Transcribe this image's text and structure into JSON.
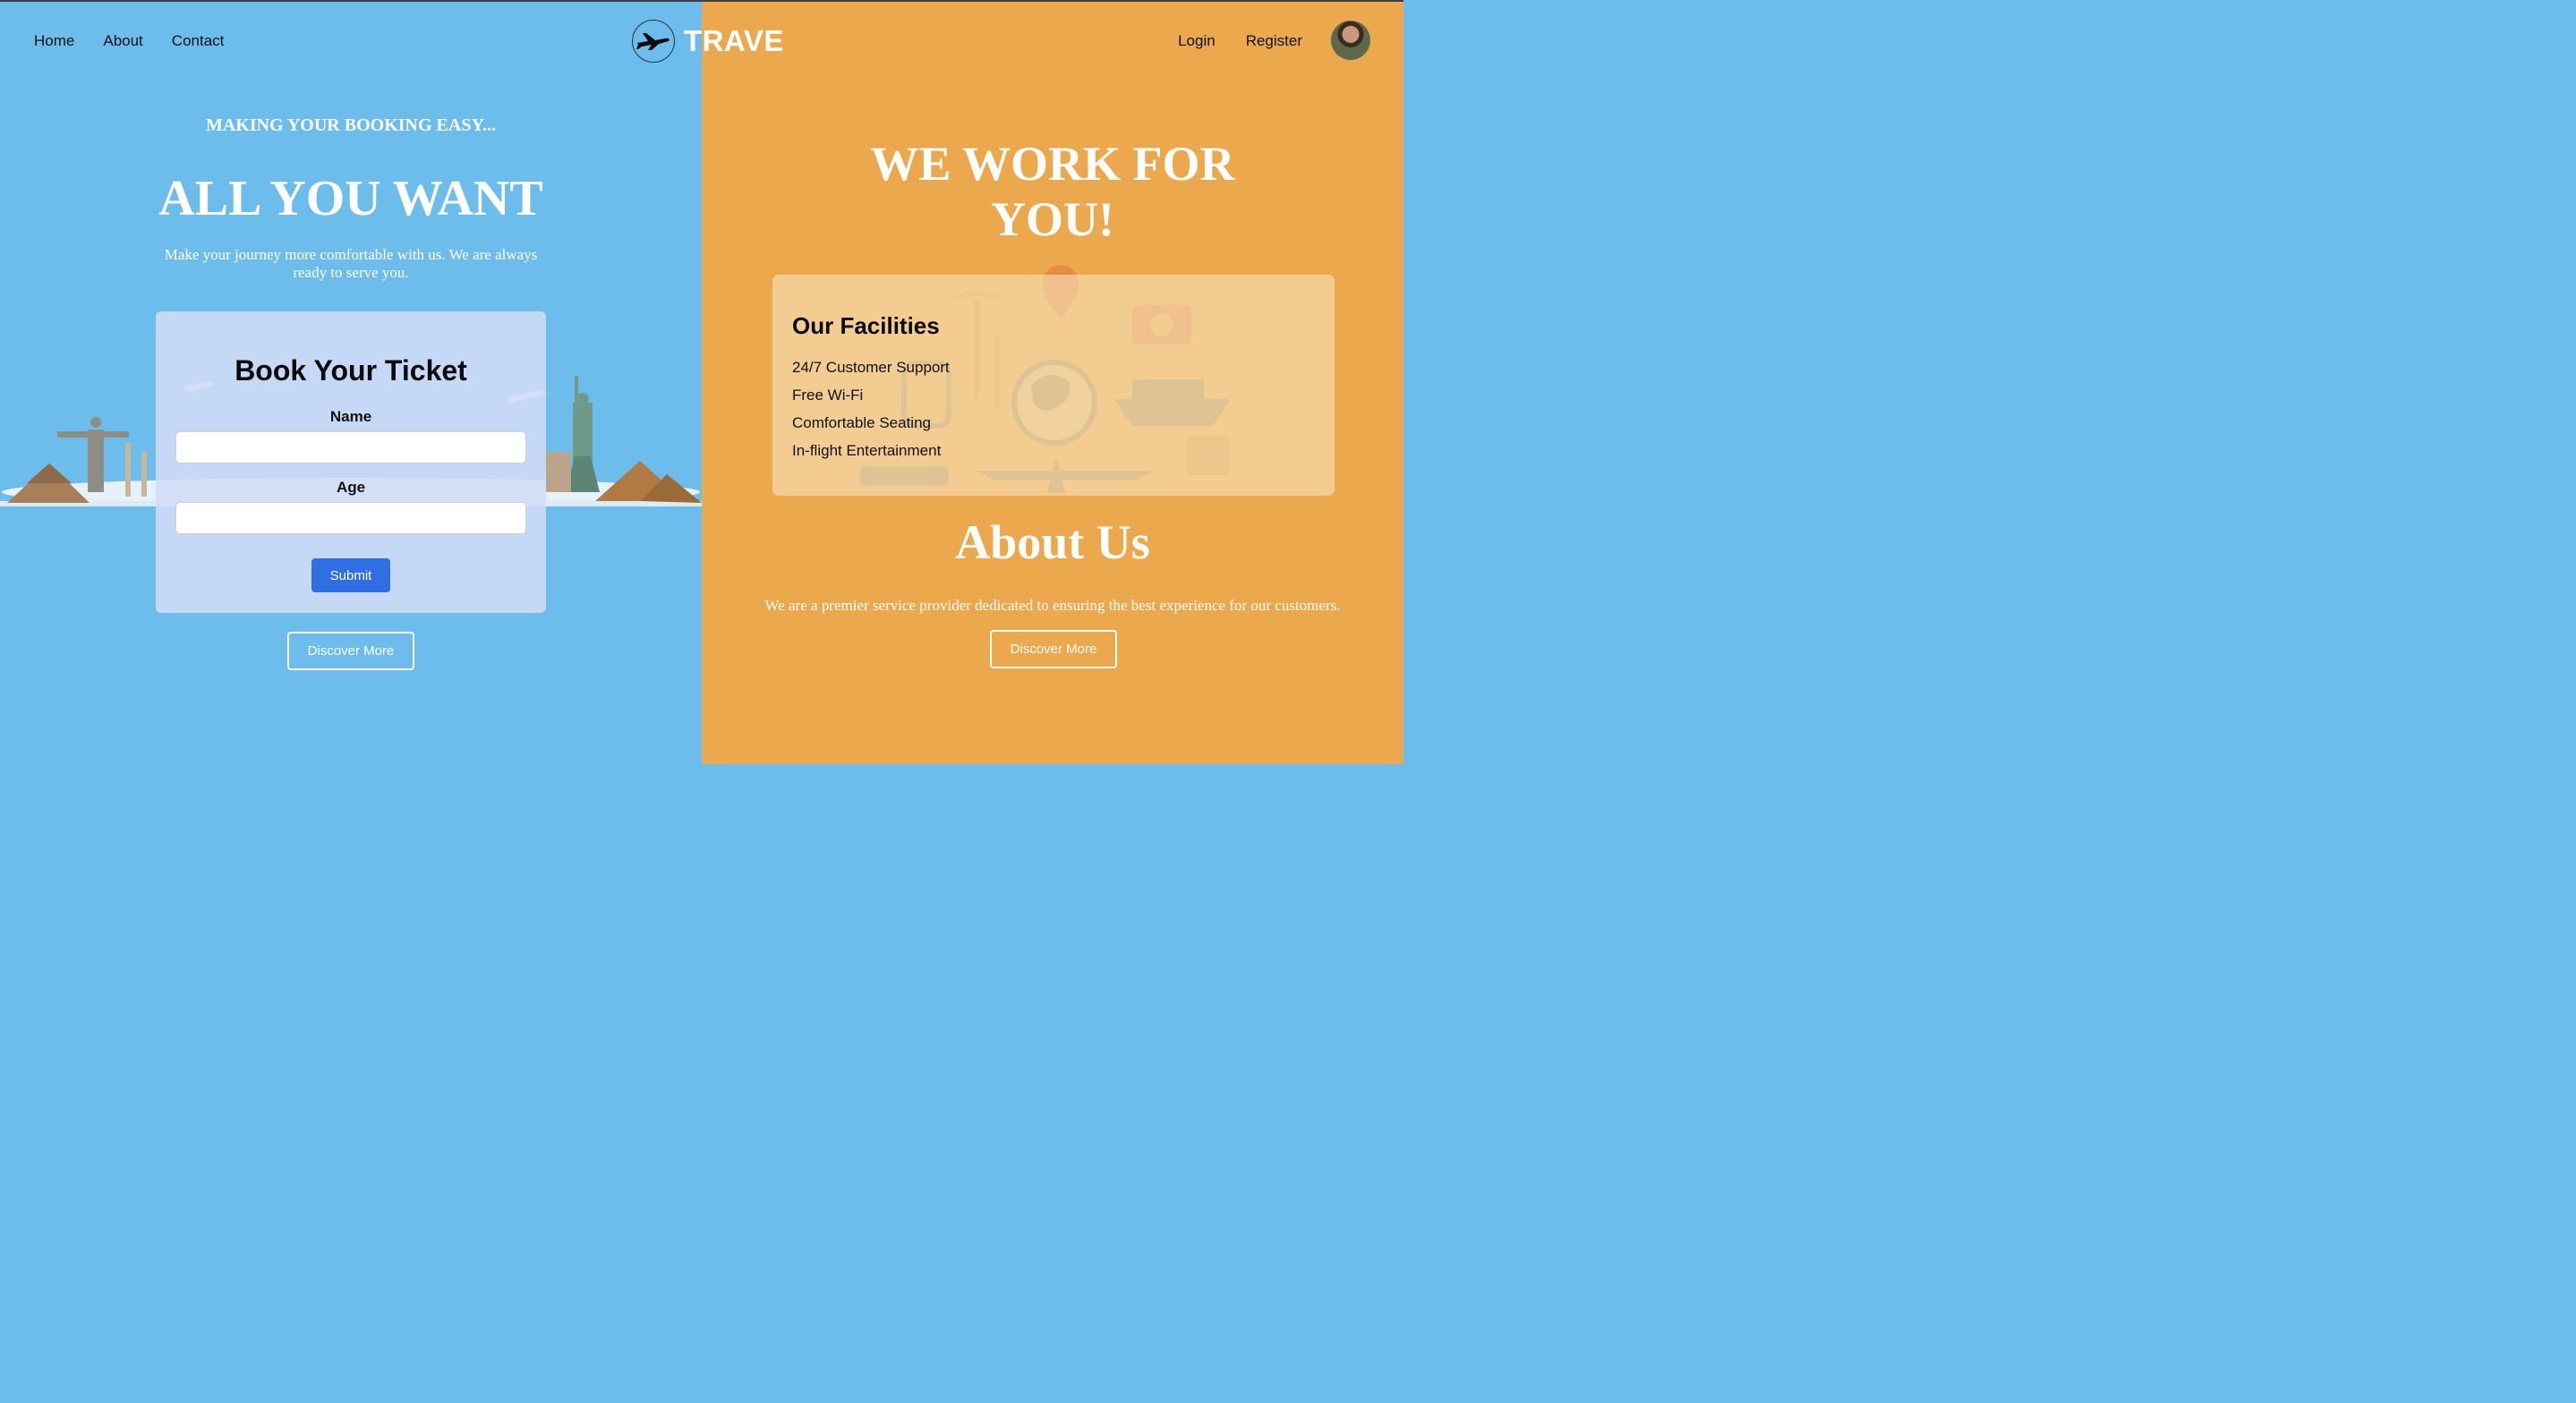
{
  "nav": {
    "links": [
      "Home",
      "About",
      "Contact"
    ],
    "brand": "TRAVE",
    "auth": [
      "Login",
      "Register"
    ]
  },
  "hero": {
    "kicker": "MAKING YOUR BOOKING EASY...",
    "title": "ALL YOU WANT",
    "subtitle": "Make your journey more comfortable with us. We are always ready to serve you."
  },
  "booking": {
    "title": "Book Your Ticket",
    "name_label": "Name",
    "name_value": "",
    "age_label": "Age",
    "age_value": "",
    "submit_label": "Submit"
  },
  "left_discover_label": "Discover More",
  "work": {
    "title": "WE WORK FOR YOU!"
  },
  "facilities": {
    "title": "Our Facilities",
    "items": [
      "24/7 Customer Support",
      "Free Wi-Fi",
      "Comfortable Seating",
      "In-flight Entertainment"
    ]
  },
  "about": {
    "title": "About Us",
    "text": "We are a premier service provider dedicated to ensuring the best experience for our customers.",
    "discover_label": "Discover More"
  },
  "colors": {
    "left_bg": "#6dbdec",
    "right_bg": "#eca84c",
    "submit_bg": "#2f6ee3"
  }
}
